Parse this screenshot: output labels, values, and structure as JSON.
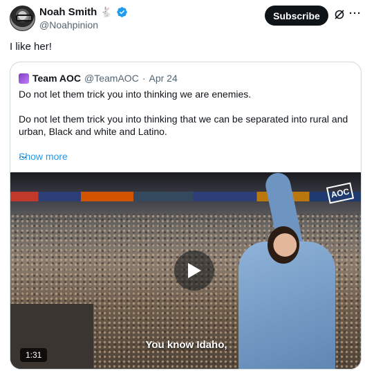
{
  "author": {
    "name": "Noah Smith",
    "emoji": "🐇",
    "handle": "@Noahpinion"
  },
  "actions": {
    "subscribe_label": "Subscribe",
    "grok_icon": "grok-icon",
    "more_icon": "···"
  },
  "tweet": {
    "text": "I like her!"
  },
  "quote": {
    "name": "Team AOC",
    "handle": "@TeamAOC",
    "separator": "·",
    "date": "Apr 24",
    "paragraph1": "Do not let them trick you into thinking we are enemies.",
    "paragraph2": "Do not let them trick you into thinking that we can be separated into rural and urban, Black and white and Latino.",
    "ellipsis": "...",
    "show_more": "Show more"
  },
  "media": {
    "caption": "You know Idaho,",
    "duration": "1:31",
    "logo_text": "AOC"
  },
  "colors": {
    "accent": "#1d9bf0",
    "text": "#0f1419",
    "secondary": "#536471"
  }
}
